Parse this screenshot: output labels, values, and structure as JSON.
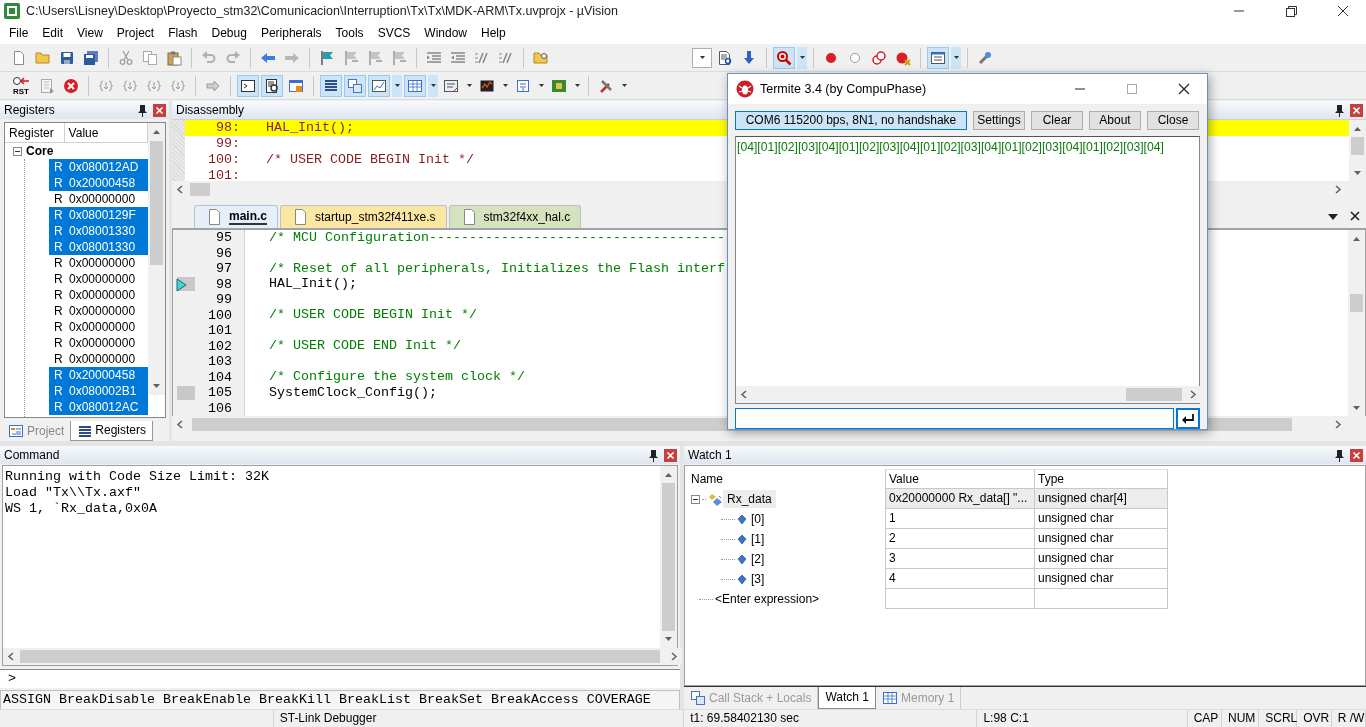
{
  "window": {
    "title": "C:\\Users\\Lisney\\Desktop\\Proyecto_stm32\\Comunicacion\\Interruption\\Tx\\Tx\\MDK-ARM\\Tx.uvprojx - µVision"
  },
  "menu": [
    "File",
    "Edit",
    "View",
    "Project",
    "Flash",
    "Debug",
    "Peripherals",
    "Tools",
    "SVCS",
    "Window",
    "Help"
  ],
  "toolbars": [
    {
      "buttons": [
        {
          "pressed": false
        },
        {
          "pressed": false
        },
        {
          "pressed": false
        },
        {
          "pressed": false
        },
        {
          "pressed": false
        },
        {
          "pressed": false
        },
        {
          "pressed": false
        },
        {
          "pressed": false
        },
        {
          "pressed": false
        },
        {
          "pressed": false
        },
        {
          "pressed": false
        },
        {
          "pressed": false
        },
        {
          "pressed": false
        },
        {
          "pressed": false
        },
        {
          "pressed": false
        },
        {
          "pressed": false
        },
        {
          "pressed": false
        },
        {
          "pressed": false
        },
        {
          "pressed": false
        },
        {
          "pressed": false
        },
        {
          "pressed": false
        },
        {
          "pressed": false
        },
        {
          "pressed": true
        },
        {
          "pressed": false
        },
        {
          "pressed": false
        },
        {
          "pressed": false
        },
        {
          "pressed": false
        },
        {
          "pressed": true
        },
        {
          "pressed": false
        }
      ]
    },
    {
      "reset_label": "RST",
      "buttons": [
        {
          "pressed": false
        },
        {
          "pressed": false
        },
        {
          "pressed": false
        },
        {
          "pressed": false
        },
        {
          "pressed": false
        },
        {
          "pressed": false
        },
        {
          "pressed": false
        },
        {
          "pressed": false
        },
        {
          "pressed": true
        },
        {
          "pressed": true
        },
        {
          "pressed": false
        },
        {
          "pressed": true
        },
        {
          "pressed": true
        },
        {
          "pressed": true
        },
        {
          "pressed": true
        },
        {
          "pressed": false
        },
        {
          "pressed": false
        },
        {
          "pressed": false
        },
        {
          "pressed": false
        },
        {
          "pressed": false
        }
      ]
    }
  ],
  "registers": {
    "title": "Registers",
    "columns": [
      "Register",
      "Value"
    ],
    "group": {
      "label": "Core",
      "expanded": true
    },
    "rows": [
      {
        "name": "R",
        "value": "0x080012AD",
        "selected": true
      },
      {
        "name": "R",
        "value": "0x20000458",
        "selected": true
      },
      {
        "name": "R",
        "value": "0x00000000",
        "selected": false
      },
      {
        "name": "R",
        "value": "0x0800129F",
        "selected": true
      },
      {
        "name": "R",
        "value": "0x08001330",
        "selected": true
      },
      {
        "name": "R",
        "value": "0x08001330",
        "selected": true
      },
      {
        "name": "R",
        "value": "0x00000000",
        "selected": false
      },
      {
        "name": "R",
        "value": "0x00000000",
        "selected": false
      },
      {
        "name": "R",
        "value": "0x00000000",
        "selected": false
      },
      {
        "name": "R",
        "value": "0x00000000",
        "selected": false
      },
      {
        "name": "R",
        "value": "0x00000000",
        "selected": false
      },
      {
        "name": "R",
        "value": "0x00000000",
        "selected": false
      },
      {
        "name": "R",
        "value": "0x00000000",
        "selected": false
      },
      {
        "name": "R",
        "value": "0x20000458",
        "selected": true
      },
      {
        "name": "R",
        "value": "0x080002B1",
        "selected": true
      },
      {
        "name": "R",
        "value": "0x080012AC",
        "selected": true
      }
    ],
    "tabs": [
      {
        "label": "Project",
        "selected": false
      },
      {
        "label": "Registers",
        "selected": true
      }
    ]
  },
  "disassembly": {
    "title": "Disassembly",
    "lines": [
      {
        "number": "98:",
        "code": "HAL_Init();",
        "current": true
      },
      {
        "number": "99:",
        "current": false
      },
      {
        "number": "100:",
        "code": "/* USER CODE BEGIN Init */",
        "current": false
      },
      {
        "number": "101:",
        "current": false
      }
    ]
  },
  "editor": {
    "tabs": [
      {
        "label": "main.c",
        "selected": true,
        "color": "#e6eef9"
      },
      {
        "label": "startup_stm32f411xe.s",
        "selected": false,
        "color": "#fbe6a2"
      },
      {
        "label": "stm32f4xx_hal.c",
        "selected": false,
        "color": "#d6e2bd"
      }
    ],
    "lines": [
      {
        "number": "95",
        "code": "/* MCU Configuration-------------------------------------",
        "kind": "comment",
        "has_code": false,
        "current": false
      },
      {
        "number": "96",
        "has_code": false,
        "current": false
      },
      {
        "number": "97",
        "code": "/* Reset of all peripherals, Initializes the Flash interf",
        "kind": "comment",
        "has_code": false,
        "current": false
      },
      {
        "number": "98",
        "code": "HAL_Init();",
        "kind": "code",
        "has_code": true,
        "current": true
      },
      {
        "number": "99",
        "has_code": false,
        "current": false
      },
      {
        "number": "100",
        "code": "/* USER CODE BEGIN Init */",
        "kind": "comment",
        "has_code": false,
        "current": false
      },
      {
        "number": "101",
        "has_code": false,
        "current": false
      },
      {
        "number": "102",
        "code": "/* USER CODE END Init */",
        "kind": "comment",
        "has_code": false,
        "current": false
      },
      {
        "number": "103",
        "has_code": false,
        "current": false
      },
      {
        "number": "104",
        "code": "/* Configure the system clock */",
        "kind": "comment",
        "has_code": false,
        "current": false
      },
      {
        "number": "105",
        "code": "SystemClock_Config();",
        "kind": "code",
        "has_code": true,
        "current": false
      },
      {
        "number": "106",
        "has_code": false,
        "current": false
      }
    ]
  },
  "termite": {
    "title": "Termite 3.4 (by CompuPhase)",
    "port": "COM6 115200 bps, 8N1, no handshake",
    "buttons": [
      "Settings",
      "Clear",
      "About",
      "Close"
    ],
    "output": "[04][01][02][03][04][01][02][03][04][01][02][03][04][01][02][03][04][01][02][03][04]"
  },
  "command": {
    "title": "Command",
    "lines": [
      "Running with Code Size Limit: 32K",
      "Load \"Tx\\\\Tx.axf\"",
      "WS 1, `Rx_data,0x0A"
    ],
    "prompt": ">",
    "help": "ASSIGN BreakDisable BreakEnable BreakKill BreakList BreakSet BreakAccess COVERAGE"
  },
  "watch": {
    "title": "Watch 1",
    "columns": [
      "Name",
      "Value",
      "Type"
    ],
    "rows": [
      {
        "name": "Rx_data",
        "value": "0x20000000 Rx_data[] \"...",
        "type": "unsigned char[4]",
        "expanded": true,
        "selected": true,
        "children": [
          {
            "name": "[0]",
            "value": "1",
            "type": "unsigned char",
            "selected": false
          },
          {
            "name": "[1]",
            "value": "2",
            "type": "unsigned char",
            "selected": false
          },
          {
            "name": "[2]",
            "value": "3",
            "type": "unsigned char",
            "selected": false
          },
          {
            "name": "[3]",
            "value": "4",
            "type": "unsigned char",
            "selected": false
          }
        ]
      }
    ],
    "new_expression": "<Enter expression>",
    "tabs": [
      {
        "label": "Call Stack + Locals",
        "selected": false
      },
      {
        "label": "Watch 1",
        "selected": true
      },
      {
        "label": "Memory 1",
        "selected": false
      }
    ]
  },
  "status_bar": [
    "ST-Link Debugger",
    "t1: 69.58402130 sec",
    "L:98 C:1",
    "CAP",
    "NUM",
    "SCRL",
    "OVR",
    "R /W"
  ]
}
